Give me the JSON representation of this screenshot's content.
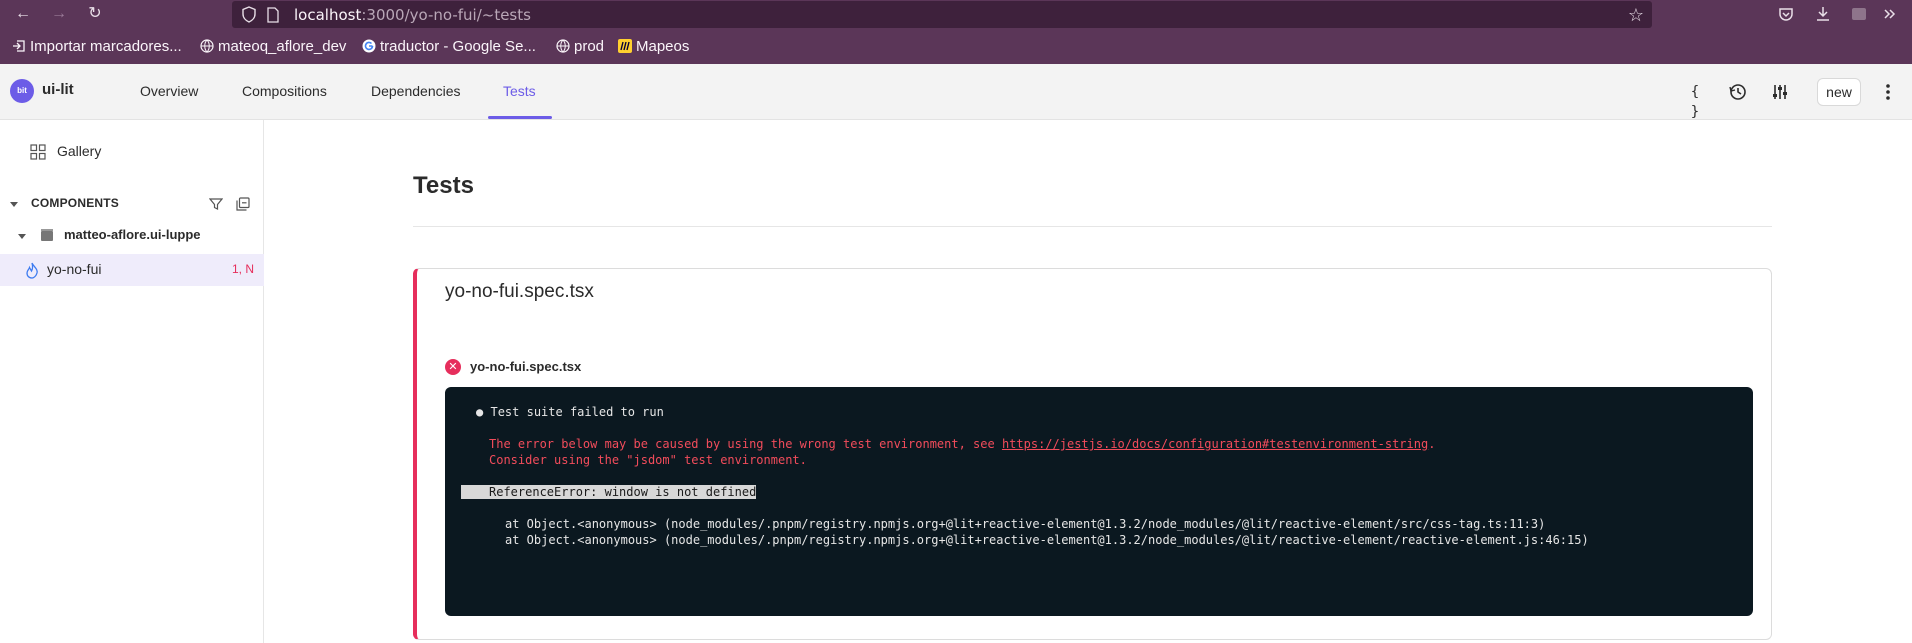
{
  "browser": {
    "url_host": "localhost",
    "url_path": ":3000/yo-no-fui/~tests",
    "bookmarks": [
      {
        "label": "Importar marcadores..."
      },
      {
        "label": "mateoq_aflore_dev"
      },
      {
        "label": "traductor - Google Se..."
      },
      {
        "label": "prod"
      },
      {
        "label": "Mapeos"
      }
    ]
  },
  "header": {
    "logo_text": "bit",
    "scope_name": "ui-lit",
    "tabs": [
      {
        "label": "Overview"
      },
      {
        "label": "Compositions"
      },
      {
        "label": "Dependencies"
      },
      {
        "label": "Tests"
      }
    ],
    "code_icon_text": "{ }",
    "new_label": "new"
  },
  "sidebar": {
    "gallery_label": "Gallery",
    "components_title": "COMPONENTS",
    "namespace": "matteo-aflore.ui-luppe",
    "component": {
      "name": "yo-no-fui",
      "badge": "1, N"
    }
  },
  "main": {
    "title": "Tests",
    "file_title": "yo-no-fui.spec.tsx",
    "fail_icon": "✕",
    "failed_file": "yo-no-fui.spec.tsx",
    "terminal": {
      "bullet": "●",
      "suite_failed": "Test suite failed to run",
      "error_prefix": "The error below may be caused by using the wrong test environment, see ",
      "error_link": "https://jestjs.io/docs/configuration#testenvironment-string",
      "error_suffix": ".",
      "consider": "Consider using the \"jsdom\" test environment.",
      "reference_error": "ReferenceError: window is not defined",
      "stack": [
        "at Object.<anonymous> (node_modules/.pnpm/registry.npmjs.org+@lit+reactive-element@1.3.2/node_modules/@lit/reactive-element/src/css-tag.ts:11:3)",
        "at Object.<anonymous> (node_modules/.pnpm/registry.npmjs.org+@lit+reactive-element@1.3.2/node_modules/@lit/reactive-element/reactive-element.js:46:15)"
      ]
    }
  }
}
